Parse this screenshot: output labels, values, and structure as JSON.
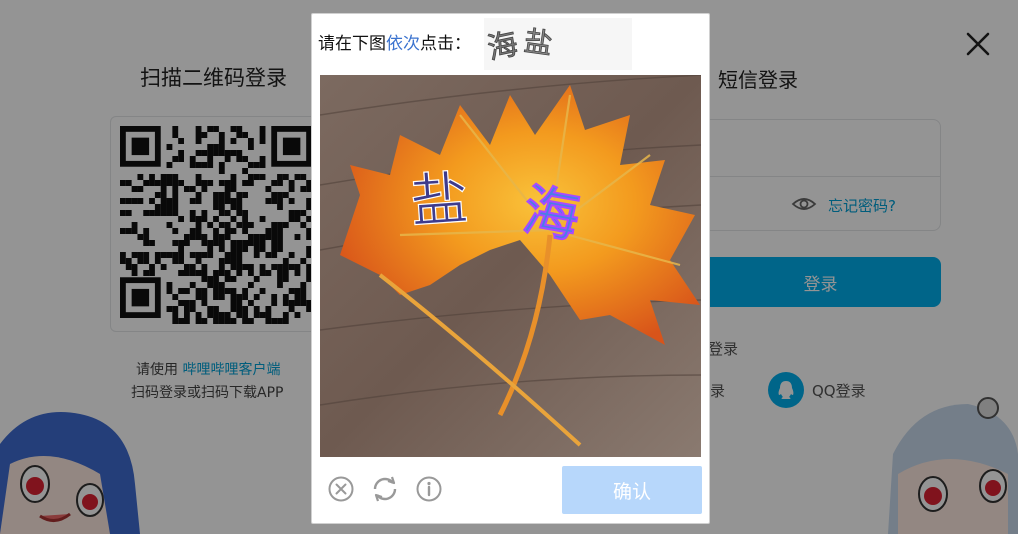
{
  "login": {
    "qr_title": "扫描二维码登录",
    "sms_title": "短信登录",
    "qr_hint_prefix": "请使用 ",
    "qr_hint_link": "哔哩哔哩客户端",
    "qr_hint_line2": "扫码登录或扫码下载APP",
    "forgot_password": "忘记密码?",
    "login_button": "登录",
    "other_login_fragment": "登录",
    "other_login_fragment2": "录",
    "qq_login": "QQ登录"
  },
  "captcha": {
    "prompt_prefix": "请在下图",
    "prompt_highlight": "依次",
    "prompt_suffix": "点击：",
    "target_chars": [
      "海",
      "盐"
    ],
    "confirm_button": "确认",
    "tools": [
      "close-icon",
      "refresh-icon",
      "info-icon"
    ]
  },
  "colors": {
    "accent": "#00aeec",
    "link": "#00a1d6",
    "prompt_highlight": "#3b73cf",
    "confirm_disabled": "#b7d7fb"
  }
}
